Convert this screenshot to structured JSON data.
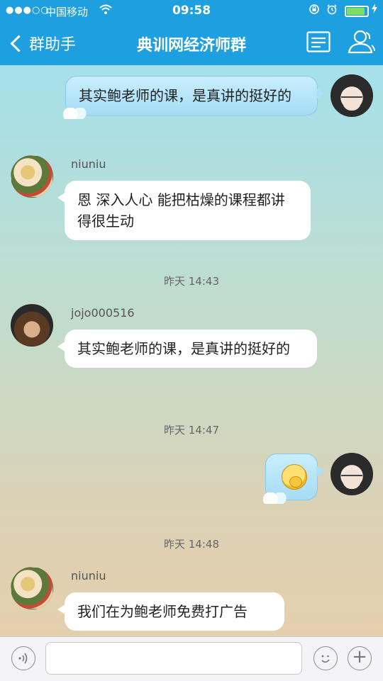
{
  "status_bar": {
    "signal_icon": "●●●○○",
    "carrier": "中国移动",
    "wifi_icon": "wifi-icon",
    "time": "09:58",
    "lock_icon": "rotation-lock-icon",
    "alarm_icon": "alarm-icon",
    "battery_level": 0.95,
    "battery_color": "#7ee05a"
  },
  "nav": {
    "back_label": "群助手",
    "title": "典训网经济师群",
    "bar_color": "#1ea0e0"
  },
  "messages": [
    {
      "side": "right",
      "sender": "",
      "text": "其实鲍老师的课，是真讲的挺好的"
    },
    {
      "side": "left",
      "sender": "niuniu",
      "text": "恩 深入人心 能把枯燥的课程都讲得很生动"
    },
    {
      "timestamp": "昨天 14:43"
    },
    {
      "side": "left",
      "sender": "jojo000516",
      "text": "其实鲍老师的课，是真讲的挺好的"
    },
    {
      "timestamp": "昨天 14:47"
    },
    {
      "side": "right",
      "sender": "",
      "emoji": "thinking-emoji"
    },
    {
      "timestamp": "昨天 14:48"
    },
    {
      "side": "left",
      "sender": "niuniu",
      "text": "我们在为鲍老师免费打广告"
    }
  ],
  "input_bar": {
    "voice_icon": "voice-icon",
    "placeholder": "",
    "emoji_icon": "emoji-icon",
    "plus_icon": "plus-icon",
    "plus_glyph": "+"
  }
}
